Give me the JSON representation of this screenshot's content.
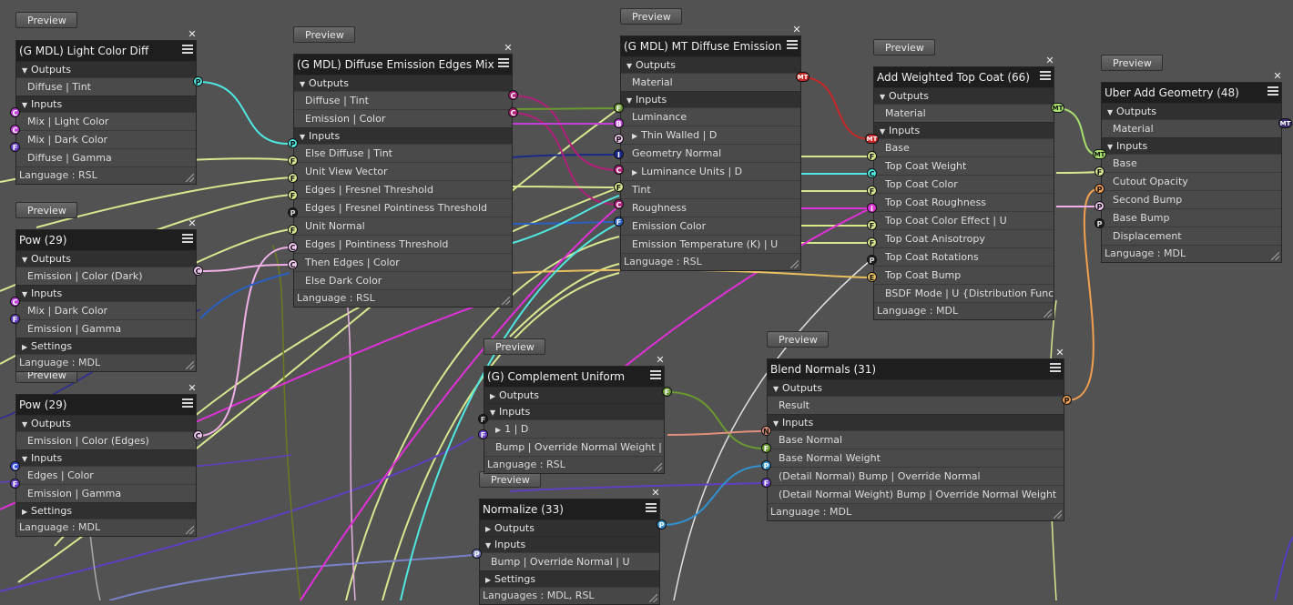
{
  "colors": {
    "P": "#50e8e0",
    "C": "#e070e8",
    "F": "#c8e880",
    "I": "#1a2a8a",
    "E": "#e8c060",
    "MT": "#c82828",
    "N": "#e0907a",
    "black": "#111111"
  },
  "preview_label": "Preview",
  "nodes": {
    "n1": {
      "title": "(G MDL) Light Color Diff",
      "outputs_label": "Outputs",
      "inputs_label": "Inputs",
      "out": [
        "Diffuse | Tint"
      ],
      "in": [
        "Mix | Light Color",
        "Mix | Dark Color",
        "Diffuse | Gamma"
      ],
      "footer": "Language : RSL"
    },
    "n2": {
      "title": "Pow (29)",
      "outputs_label": "Outputs",
      "inputs_label": "Inputs",
      "out": [
        "Emission | Color (Dark)"
      ],
      "in": [
        "Mix | Dark Color",
        "Emission | Gamma"
      ],
      "settings_label": "Settings",
      "footer": "Language : MDL"
    },
    "n3": {
      "title": "Pow (29)",
      "outputs_label": "Outputs",
      "inputs_label": "Inputs",
      "out": [
        "Emission | Color (Edges)"
      ],
      "in": [
        "Edges | Color",
        "Emission | Gamma"
      ],
      "settings_label": "Settings",
      "footer": "Language : MDL"
    },
    "n4": {
      "title": "(G MDL) Diffuse Emission Edges Mix",
      "outputs_label": "Outputs",
      "inputs_label": "Inputs",
      "out": [
        "Diffuse | Tint",
        "Emission | Color"
      ],
      "in": [
        "Else Diffuse | Tint",
        "Unit View Vector",
        "Edges | Fresnel Threshold",
        "Edges | Fresnel Pointiness Threshold",
        "Unit Normal",
        "Edges | Pointiness Threshold",
        "Then Edges | Color",
        "Else Dark Color"
      ],
      "footer": "Language : RSL"
    },
    "n5": {
      "title": "(G MDL) MT Diffuse Emission",
      "outputs_label": "Outputs",
      "inputs_label": "Inputs",
      "out": [
        "Material"
      ],
      "in": [
        "Luminance",
        "Thin Walled  | D",
        "Geometry Normal",
        "Luminance Units  | D",
        "Tint",
        "Roughness",
        "Emission Color",
        "Emission Temperature (K)  | U"
      ],
      "footer": "Language : RSL"
    },
    "n6": {
      "title": "Add Weighted Top Coat (66)",
      "outputs_label": "Outputs",
      "inputs_label": "Inputs",
      "out": [
        "Material"
      ],
      "in": [
        "Base",
        "Top Coat Weight",
        "Top Coat Color",
        "Top Coat Roughness",
        "Top Coat Color Effect  | U",
        "Top Coat Anisotropy",
        "Top Coat Rotations",
        "Top Coat Bump",
        "BSDF Mode  | U {Distribution Function"
      ],
      "footer": "Language : MDL"
    },
    "n7": {
      "title": "Uber Add Geometry (48)",
      "outputs_label": "Outputs",
      "inputs_label": "Inputs",
      "out": [
        "Material"
      ],
      "in": [
        "Base",
        "Cutout Opacity",
        "Second Bump",
        "Base Bump",
        "Displacement"
      ],
      "footer": "Language : MDL"
    },
    "n8": {
      "title": "(G) Complement Uniform",
      "outputs_label": "Outputs",
      "inputs_label": "Inputs",
      "in": [
        "1  | D",
        "Bump | Override Normal Weight  | U"
      ],
      "footer": "Language : RSL"
    },
    "n9": {
      "title": "Normalize (33)",
      "outputs_label": "Outputs",
      "inputs_label": "Inputs",
      "in": [
        "Bump | Override Normal  | U"
      ],
      "settings_label": "Settings",
      "footer": "Languages : MDL, RSL"
    },
    "n10": {
      "title": "Blend Normals (31)",
      "outputs_label": "Outputs",
      "inputs_label": "Inputs",
      "out": [
        "Result"
      ],
      "in": [
        "Base Normal",
        "Base Normal Weight",
        "(Detail Normal) Bump | Override Normal",
        "(Detail Normal Weight) Bump | Override Normal Weight"
      ],
      "footer": "Language : MDL"
    }
  }
}
